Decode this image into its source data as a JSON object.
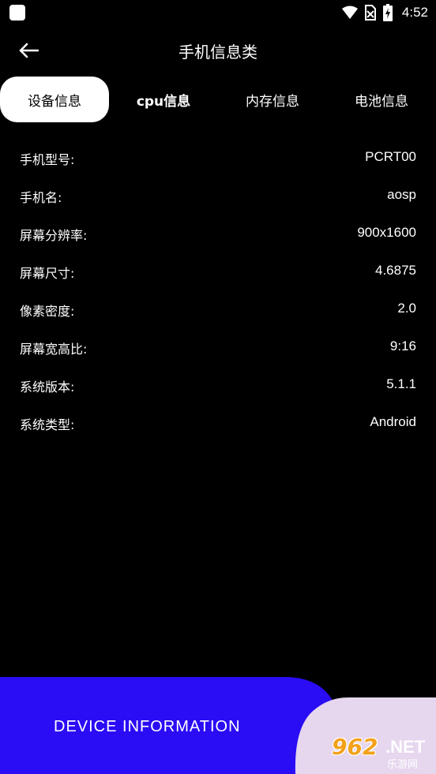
{
  "status_bar": {
    "time": "4:52",
    "icons": [
      "app-notification-icon",
      "wifi-icon",
      "no-sim-icon",
      "battery-charging-icon"
    ]
  },
  "header": {
    "title": "手机信息类",
    "back_icon": "arrow-left-icon"
  },
  "tabs": [
    {
      "label": "设备信息",
      "active": true
    },
    {
      "label": "cpu信息",
      "active": false
    },
    {
      "label": "内存信息",
      "active": false
    },
    {
      "label": "电池信息",
      "active": false
    }
  ],
  "device_info": [
    {
      "label": "手机型号:",
      "value": "PCRT00"
    },
    {
      "label": "手机名:",
      "value": "aosp"
    },
    {
      "label": "屏幕分辨率:",
      "value": "900x1600"
    },
    {
      "label": "屏幕尺寸:",
      "value": "4.6875"
    },
    {
      "label": "像素密度:",
      "value": "2.0"
    },
    {
      "label": "屏幕宽高比:",
      "value": "9:16"
    },
    {
      "label": "系统版本:",
      "value": "5.1.1"
    },
    {
      "label": "系统类型:",
      "value": "Android"
    }
  ],
  "footer": {
    "banner_text": "DEVICE INFORMATION",
    "colors": {
      "banner": "#2a0cf5",
      "accent": "#e6d6ee"
    }
  },
  "watermark": {
    "number": "962",
    "suffix": ".NET",
    "sub": "乐游网"
  }
}
